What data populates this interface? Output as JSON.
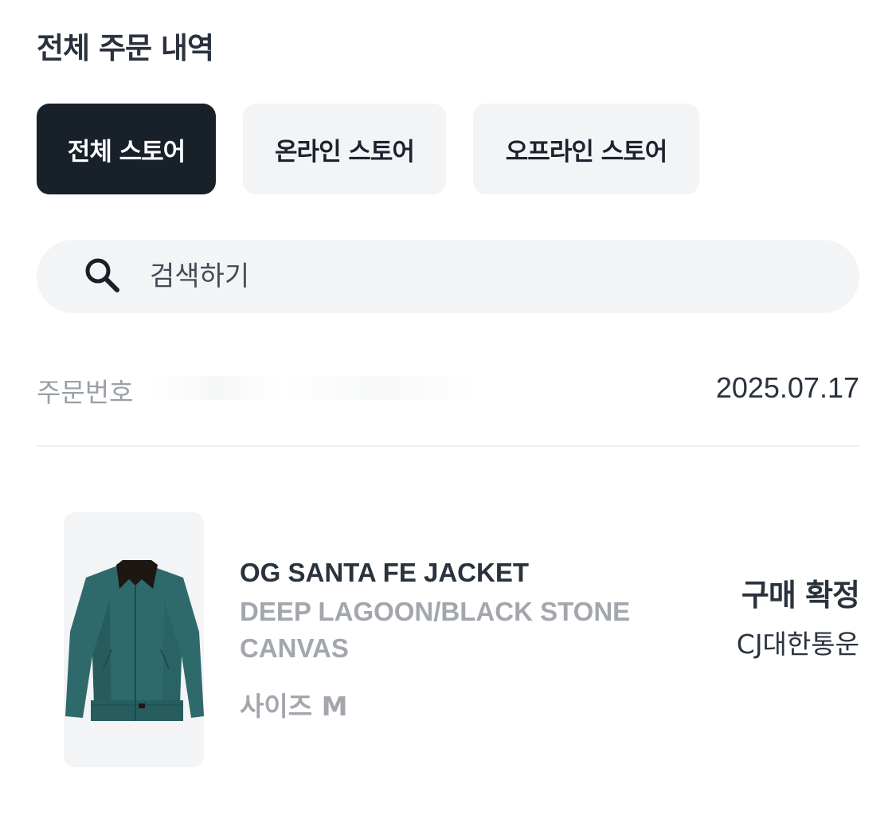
{
  "header": {
    "title": "전체 주문 내역"
  },
  "tabs": [
    {
      "label": "전체 스토어",
      "active": true
    },
    {
      "label": "온라인 스토어",
      "active": false
    },
    {
      "label": "오프라인 스토어",
      "active": false
    }
  ],
  "search": {
    "placeholder": "검색하기",
    "icon": "search-icon"
  },
  "order": {
    "number_label": "주문번호",
    "date": "2025.07.17"
  },
  "item": {
    "name": "OG SANTA FE JACKET",
    "color_line1": "DEEP LAGOON/BLACK STONE",
    "color_line2": "CANVAS",
    "size": "사이즈 M",
    "status": "구매 확정",
    "carrier": "CJ대한통운"
  },
  "colors": {
    "active_tab": "#18202a",
    "inactive_tab": "#f3f4f6",
    "muted_text": "#a3a7ad",
    "jacket_body": "#2e6a6c",
    "jacket_collar": "#1d1714"
  }
}
